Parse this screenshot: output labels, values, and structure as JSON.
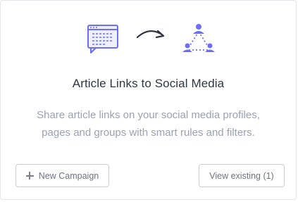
{
  "card": {
    "title": "Article Links to Social Media",
    "description_line1": "Share article links on your social media profiles,",
    "description_line2": "pages and groups with smart rules and filters.",
    "illustration": {
      "left_icon": "article-document-icon",
      "middle_icon": "curved-arrow-icon",
      "right_icon": "social-network-icon",
      "accent_color": "#6c6ff5",
      "arrow_color": "#2f3542"
    }
  },
  "buttons": {
    "new_campaign_icon": "plus-icon",
    "new_campaign_label": "New Campaign",
    "view_existing_label": "View existing (1)"
  }
}
